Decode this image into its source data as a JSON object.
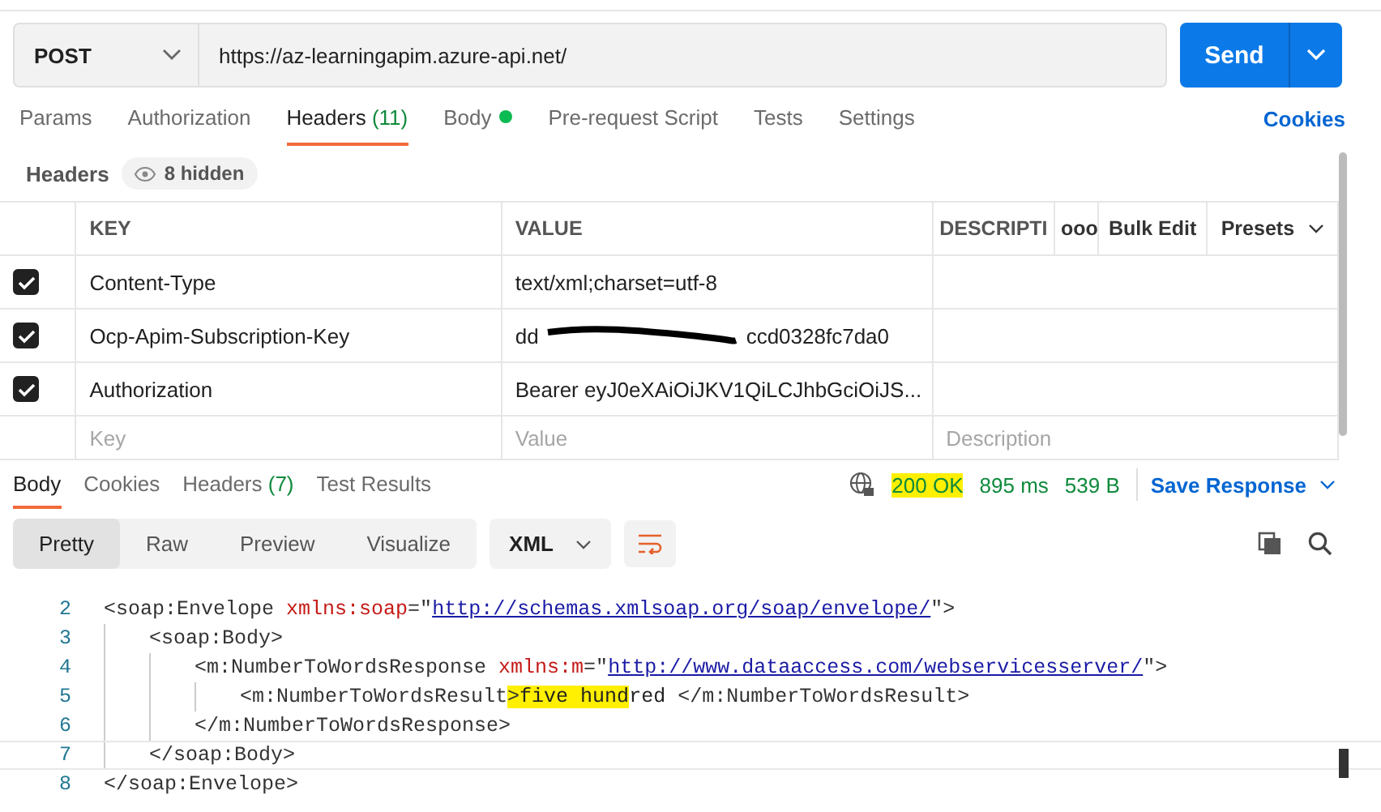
{
  "request": {
    "method": "POST",
    "url": "https://az-learningapim.azure-api.net/",
    "send": "Send"
  },
  "tabs": [
    {
      "label": "Params",
      "selected": false
    },
    {
      "label": "Authorization",
      "selected": false
    },
    {
      "label": "Headers",
      "count": "(11)",
      "selected": true
    },
    {
      "label": "Body",
      "dot": true,
      "selected": false
    },
    {
      "label": "Pre-request Script",
      "selected": false
    },
    {
      "label": "Tests",
      "selected": false
    },
    {
      "label": "Settings",
      "selected": false
    }
  ],
  "cookies_link": "Cookies",
  "headers_bar": {
    "label": "Headers",
    "hidden": "8 hidden"
  },
  "table": {
    "columns": [
      "KEY",
      "VALUE",
      "DESCRIPTI"
    ],
    "more": "ooo",
    "bulk_edit": "Bulk Edit",
    "presets": "Presets",
    "rows": [
      {
        "checked": true,
        "key": "Content-Type",
        "value": [
          "text/xml;charset=utf-8"
        ]
      },
      {
        "checked": true,
        "key": "Ocp-Apim-Subscription-Key",
        "value": [
          "dd",
          "ccd0328fc7da0"
        ],
        "redacted": true
      },
      {
        "checked": true,
        "key": "Authorization",
        "value": [
          "Bearer eyJ0eXAiOiJKV1QiLCJhbGciOiJS..."
        ]
      }
    ],
    "placeholders": {
      "key": "Key",
      "value": "Value",
      "description": "Description"
    }
  },
  "response": {
    "tabs": [
      {
        "label": "Body",
        "selected": true
      },
      {
        "label": "Cookies",
        "selected": false
      },
      {
        "label": "Headers",
        "count": "(7)",
        "selected": false
      },
      {
        "label": "Test Results",
        "selected": false
      }
    ],
    "status": "200 OK",
    "time": "895 ms",
    "size": "539 B",
    "save": "Save Response",
    "views": [
      {
        "label": "Pretty",
        "selected": true
      },
      {
        "label": "Raw",
        "selected": false
      },
      {
        "label": "Preview",
        "selected": false
      },
      {
        "label": "Visualize",
        "selected": false
      }
    ],
    "format": "XML"
  },
  "code": [
    {
      "number": "2",
      "tokens": [
        {
          "kind": "tag",
          "text": "<soap:Envelope "
        },
        {
          "kind": "attr",
          "text": "xmlns:soap"
        },
        {
          "kind": "tag",
          "text": "=\""
        },
        {
          "kind": "link",
          "text": "http://schemas.xmlsoap.org/soap/envelope/"
        },
        {
          "kind": "tag",
          "text": "\">"
        }
      ],
      "children": [
        {
          "number": "3",
          "tokens": [
            {
              "kind": "tag",
              "text": "<soap:Body>"
            }
          ],
          "children": [
            {
              "number": "4",
              "tokens": [
                {
                  "kind": "tag",
                  "text": "<m:NumberToWordsResponse "
                },
                {
                  "kind": "attr",
                  "text": "xmlns:m"
                },
                {
                  "kind": "tag",
                  "text": "=\""
                },
                {
                  "kind": "link",
                  "text": "http://www.dataaccess.com/webservicesserver/"
                },
                {
                  "kind": "tag",
                  "text": "\">"
                }
              ],
              "children": [
                {
                  "number": "5",
                  "tokens": [
                    {
                      "kind": "tag",
                      "text": "<m:NumberToWordsResult"
                    },
                    {
                      "kind": "tag",
                      "text": ">",
                      "highlighted": true
                    },
                    {
                      "kind": "text",
                      "text": "five hund",
                      "highlighted": true
                    },
                    {
                      "kind": "text",
                      "text": "red "
                    },
                    {
                      "kind": "tag",
                      "text": "</m:NumberToWordsResult>"
                    }
                  ]
                }
              ]
            },
            {
              "number": "6",
              "tokens": [
                {
                  "kind": "tag",
                  "text": "</m:NumberToWordsResponse>"
                }
              ]
            }
          ]
        },
        {
          "number": "7",
          "current": true,
          "tokens": [
            {
              "kind": "tag",
              "text": "</soap:Body>"
            }
          ]
        }
      ]
    },
    {
      "number": "8",
      "tokens": [
        {
          "kind": "tag",
          "text": "</soap:Envelope>"
        }
      ]
    }
  ]
}
